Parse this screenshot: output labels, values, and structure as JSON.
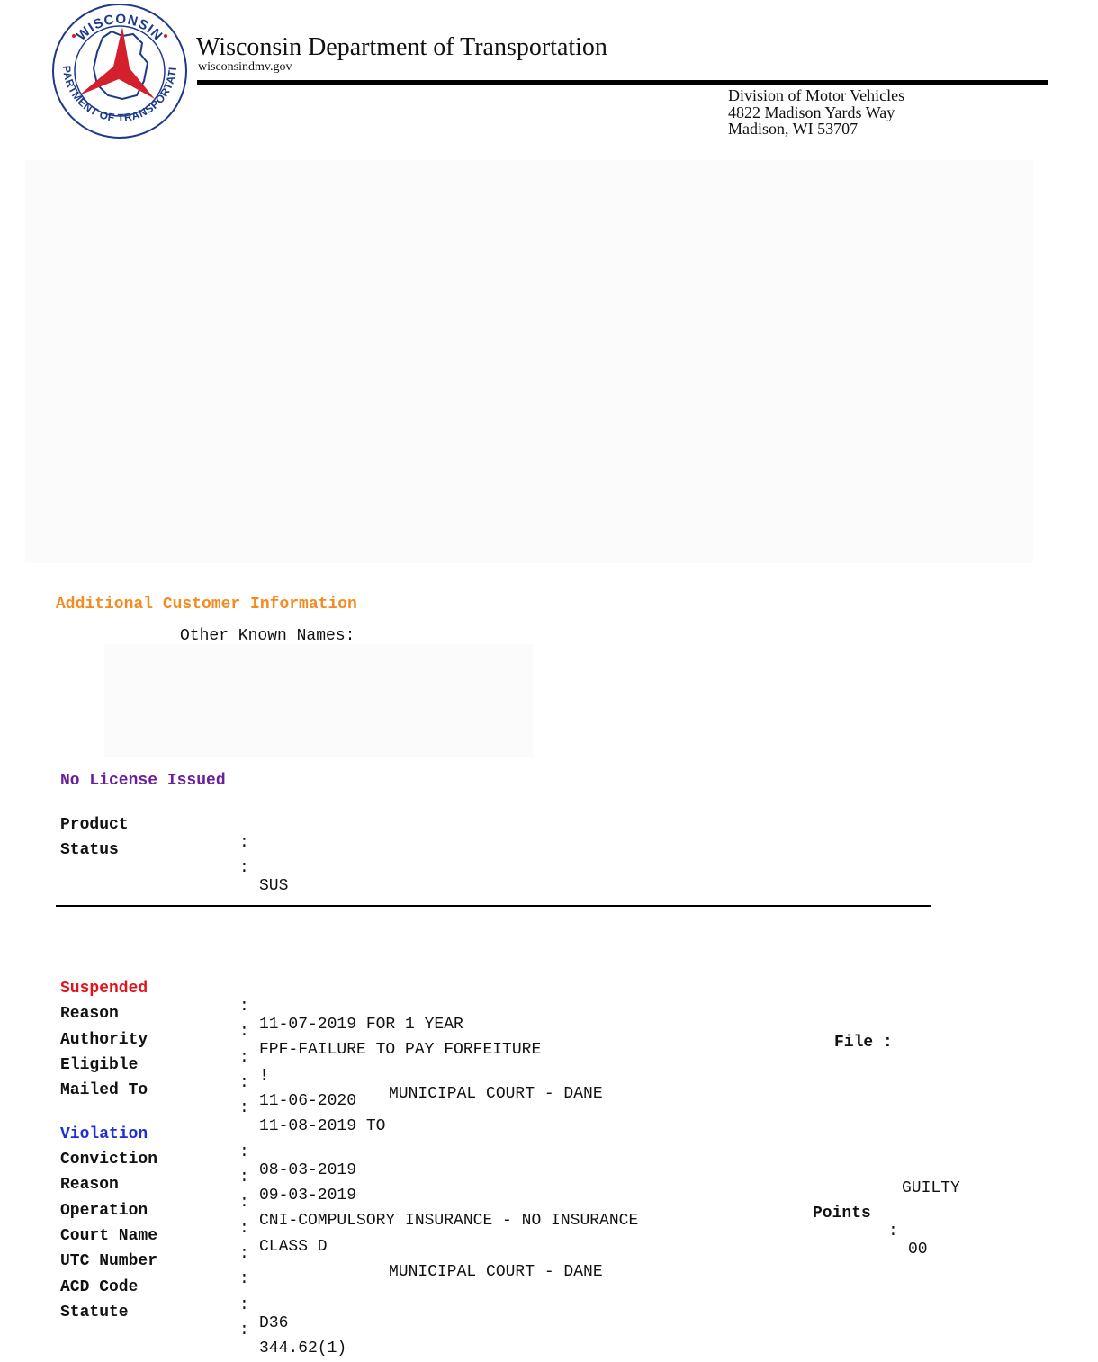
{
  "header": {
    "logo": {
      "icon": "wisconsin-dot-seal",
      "arc_top": "WISCONSIN",
      "arc_sides": "DEPARTMENT OF TRANSPORTATION",
      "colors": {
        "ring": "#1b3a8c",
        "emblem": "#d4202c"
      }
    },
    "agency_name": "Wisconsin Department of Transportation",
    "agency_url": "wisconsindmv.gov",
    "address": {
      "division": "Division of Motor Vehicles",
      "street": "4822 Madison Yards Way",
      "city": "Madison, WI 53707"
    }
  },
  "customer": {
    "section_title": "Additional Customer Information",
    "other_names_label": "Other Known Names:"
  },
  "license": {
    "title": "No License Issued",
    "product_label": "Product",
    "product_value": "",
    "status_label": "Status",
    "status_value": "SUS"
  },
  "suspension": {
    "title": "Suspended",
    "date_value": "11-07-2019 FOR 1 YEAR",
    "file_label": "File :",
    "reason_label": "Reason",
    "reason_value": "FPF-FAILURE TO PAY FORFEITURE",
    "authority_label": "Authority",
    "authority_prefix": "!",
    "authority_value": "MUNICIPAL COURT - DANE",
    "eligible_label": "Eligible",
    "eligible_value": "11-06-2020",
    "mailed_label": "Mailed To",
    "mailed_value": "11-08-2019 TO"
  },
  "violation": {
    "title": "Violation",
    "date_value": "08-03-2019",
    "verdict": "GUILTY",
    "conviction_label": "Conviction",
    "conviction_value": "09-03-2019",
    "points_label": "Points",
    "points_value": "00",
    "reason_label": "Reason",
    "reason_value": "CNI-COMPULSORY INSURANCE - NO INSURANCE",
    "operation_label": "Operation",
    "operation_value": "CLASS D",
    "court_label": "Court Name",
    "court_value": "MUNICIPAL COURT - DANE",
    "utc_label": "UTC Number",
    "utc_value": "",
    "acd_label": "ACD Code",
    "acd_value": "D36",
    "statute_label": "Statute",
    "statute_value": "344.62(1)"
  },
  "colors": {
    "section_orange": "#f58a1f",
    "license_purple": "#6a1e9c",
    "suspended_red": "#e0141c",
    "violation_blue": "#1d2fd6"
  }
}
